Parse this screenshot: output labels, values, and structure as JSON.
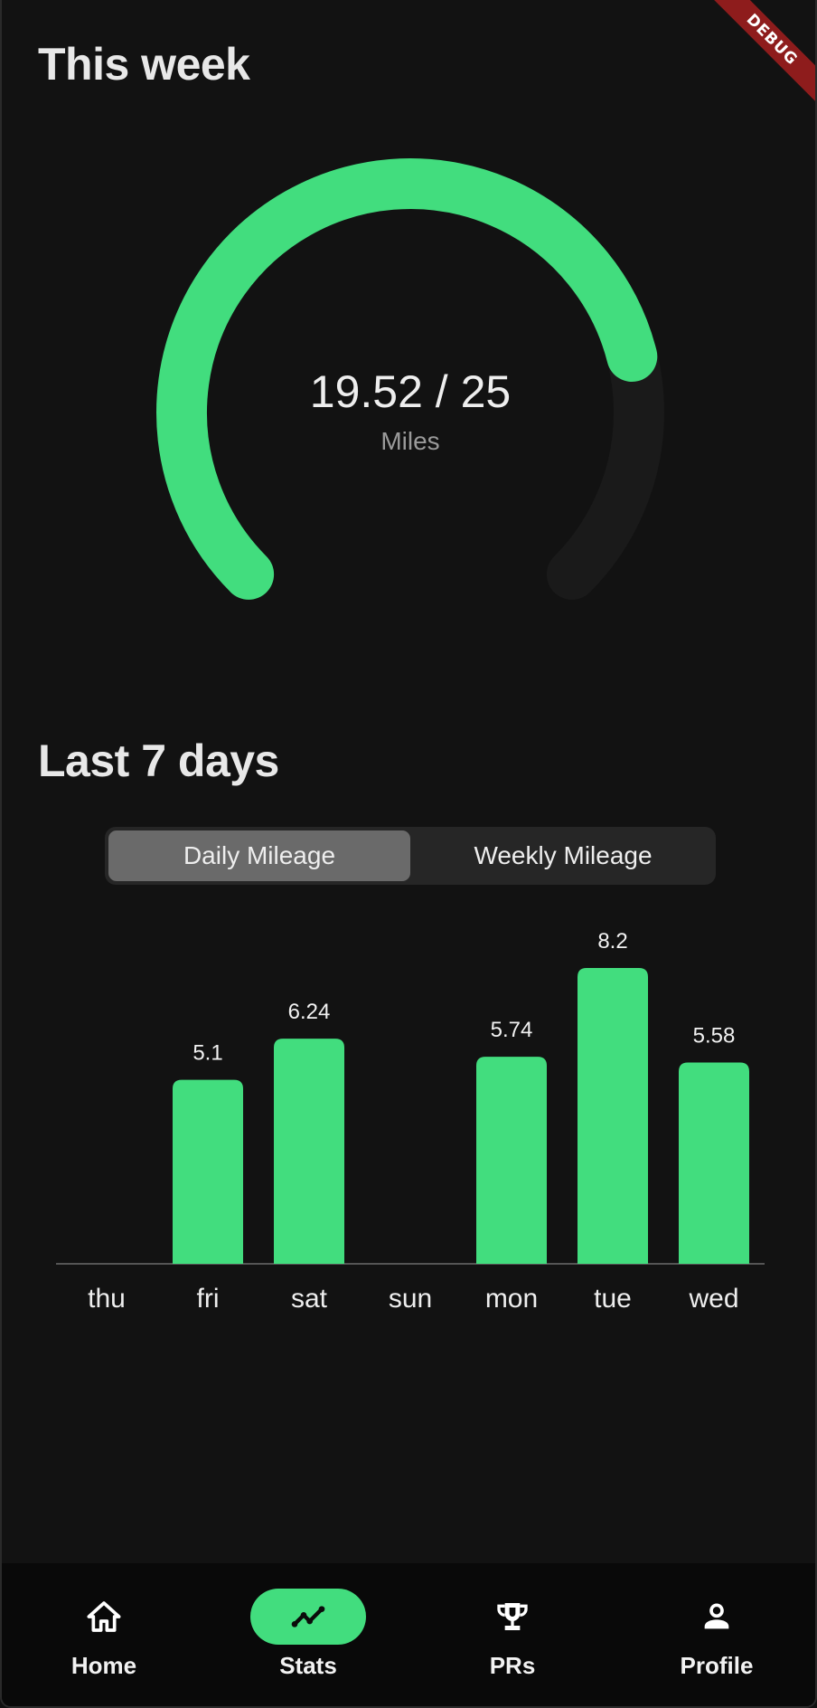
{
  "debug_banner": "DEBUG",
  "this_week": {
    "title": "This week",
    "progress_text": "19.52 / 25",
    "unit": "Miles",
    "current": 19.52,
    "goal": 25
  },
  "last_7_days": {
    "title": "Last 7 days",
    "toggle": {
      "options": [
        "Daily Mileage",
        "Weekly Mileage"
      ],
      "selected": "Daily Mileage"
    }
  },
  "colors": {
    "accent": "#42dd7e",
    "background": "#121212",
    "track": "#1a1a1a",
    "navbar": "#090909"
  },
  "chart_data": {
    "type": "bar",
    "categories": [
      "thu",
      "fri",
      "sat",
      "sun",
      "mon",
      "tue",
      "wed"
    ],
    "values": [
      0,
      5.1,
      6.24,
      0,
      5.74,
      8.2,
      5.58
    ],
    "data_labels": [
      "",
      "5.1",
      "6.24",
      "",
      "5.74",
      "8.2",
      "5.58"
    ],
    "title": "",
    "xlabel": "",
    "ylabel": "",
    "ylim": [
      0,
      8.2
    ],
    "grid": false,
    "legend": "none"
  },
  "nav": {
    "items": [
      {
        "label": "Home",
        "icon": "home-icon"
      },
      {
        "label": "Stats",
        "icon": "stats-icon"
      },
      {
        "label": "PRs",
        "icon": "trophy-icon"
      },
      {
        "label": "Profile",
        "icon": "profile-icon"
      }
    ],
    "active": "Stats"
  }
}
